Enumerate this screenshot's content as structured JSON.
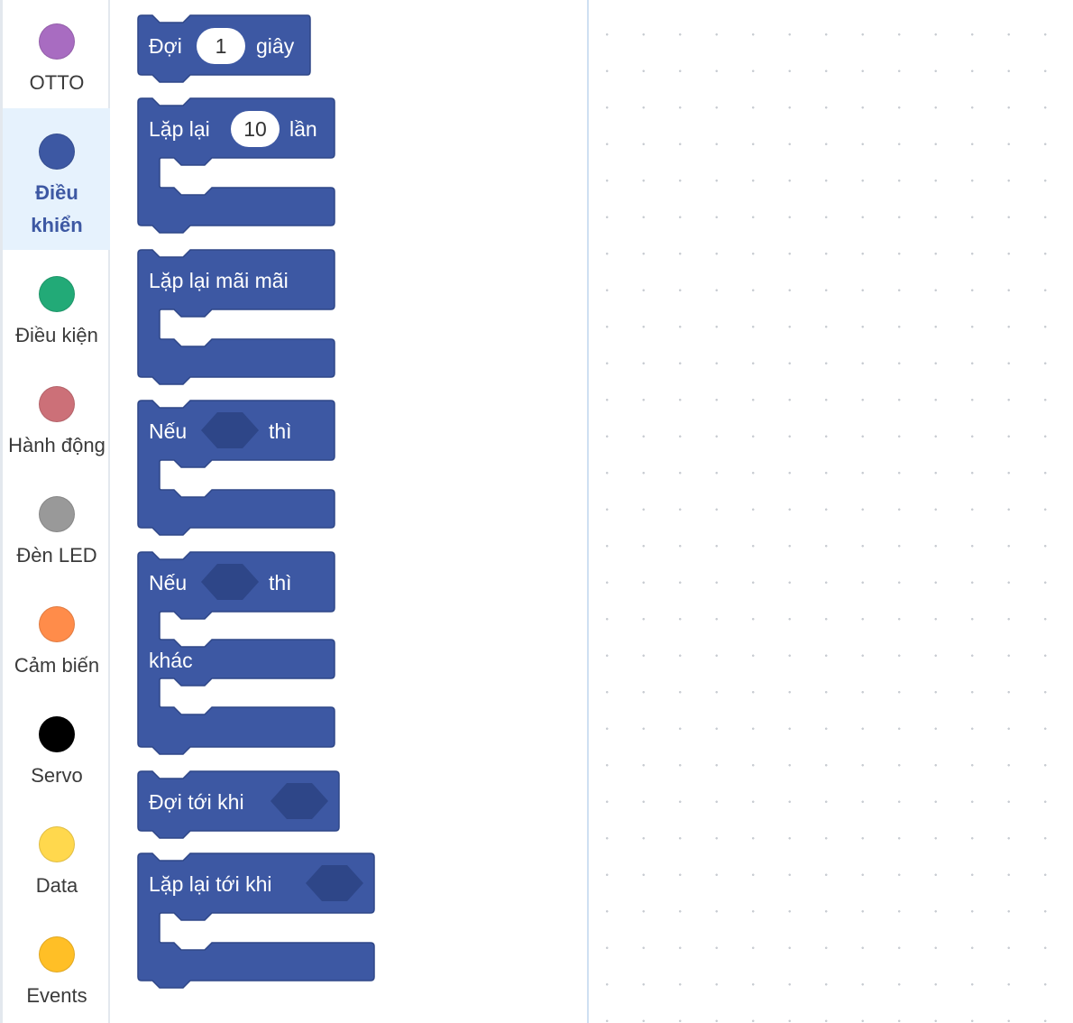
{
  "sidebar": {
    "categories": [
      {
        "label": "OTTO",
        "color": "#a86cc1"
      },
      {
        "label": "Điều khiển",
        "color": "#3d58a3"
      },
      {
        "label": "Điều kiện",
        "color": "#22aa77"
      },
      {
        "label": "Hành động",
        "color": "#cc7078"
      },
      {
        "label": "Đèn LED",
        "color": "#999999"
      },
      {
        "label": "Cảm biến",
        "color": "#ff8c4a"
      },
      {
        "label": "Servo",
        "color": "#000000"
      },
      {
        "label": "Data",
        "color": "#ffd84d"
      },
      {
        "label": "Events",
        "color": "#ffbf26"
      }
    ],
    "selected": "Điều khiển"
  },
  "palette": {
    "block_color": "#3d58a3",
    "wait": {
      "prefix": "Đợi",
      "value": "1",
      "suffix": "giây"
    },
    "repeat": {
      "prefix": "Lặp lại",
      "value": "10",
      "suffix": "lần"
    },
    "forever": {
      "label": "Lặp lại mãi mãi"
    },
    "if_then": {
      "prefix": "Nếu",
      "suffix": "thì"
    },
    "if_else": {
      "prefix": "Nếu",
      "suffix": "thì",
      "else_label": "khác"
    },
    "wait_until": {
      "label": "Đợi tới khi"
    },
    "repeat_until": {
      "label": "Lặp lại tới khi"
    }
  }
}
